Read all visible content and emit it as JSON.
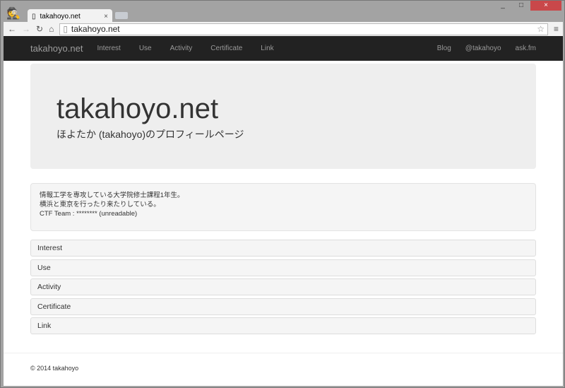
{
  "browser": {
    "tab_title": "takahoyo.net",
    "url": "takahoyo.net",
    "minimize": "_",
    "maximize": "□",
    "close": "×",
    "tab_close": "×"
  },
  "nav": {
    "brand": "takahoyo.net",
    "items": [
      "Interest",
      "Use",
      "Activity",
      "Certificate",
      "Link"
    ],
    "right": [
      "Blog",
      "@takahoyo",
      "ask.fm"
    ]
  },
  "jumbotron": {
    "title": "takahoyo.net",
    "subtitle": "ほよたか (takahoyo)のプロフィールページ"
  },
  "about": [
    "情報工学を専攻している大学院修士課程1年生。",
    "横浜と東京を行ったり来たりしている。",
    "CTF Team : ******** (unreadable)"
  ],
  "sections": [
    "Interest",
    "Use",
    "Activity",
    "Certificate",
    "Link"
  ],
  "footer": "© 2014 takahoyo"
}
